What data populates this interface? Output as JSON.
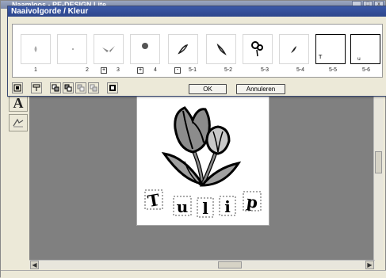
{
  "app": {
    "title": "Naamloos - PE-DESIGN Lite",
    "sys_min": "_",
    "sys_max": "□",
    "sys_close": "x"
  },
  "dialog": {
    "title": "Naaivolgorde / Kleur",
    "thumbnails": [
      {
        "label": "1",
        "expander": ""
      },
      {
        "label": "2",
        "expander": ""
      },
      {
        "label": "3",
        "expander": "+"
      },
      {
        "label": "4",
        "expander": "+"
      },
      {
        "label": "5-1",
        "expander": "-"
      },
      {
        "label": "5-2",
        "expander": ""
      },
      {
        "label": "5-3",
        "expander": ""
      },
      {
        "label": "5-4",
        "expander": ""
      },
      {
        "label": "5-5",
        "expander": ""
      },
      {
        "label": "5-6",
        "expander": ""
      }
    ],
    "ok_label": "OK",
    "cancel_label": "Annuleren"
  },
  "design": {
    "text": [
      "T",
      "u",
      "l",
      "i",
      "p"
    ]
  },
  "colors": {
    "dialog_title_bg": "#2d468b",
    "workspace_bg": "#808080",
    "tulip_gray": "#8c8c8c",
    "leaf_gray": "#a0a0a0"
  },
  "icons": [
    "zoom-icon",
    "sew-order-icon",
    "move-front-icon",
    "move-back-icon",
    "thread-color-icon",
    "text-tool-icon",
    "select-tool-icon"
  ]
}
